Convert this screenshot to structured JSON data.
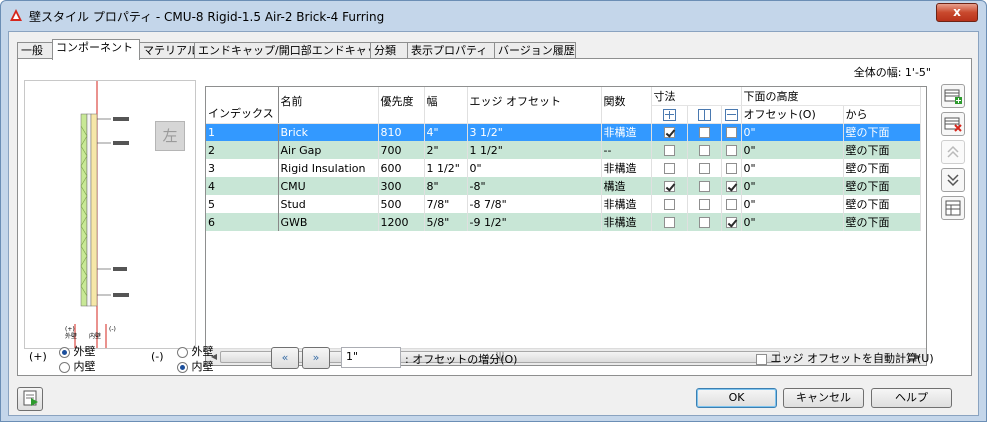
{
  "window": {
    "title": "壁スタイル プロパティ - CMU-8 Rigid-1.5 Air-2 Brick-4 Furring",
    "close_label": "x"
  },
  "tabs": [
    {
      "label": "一般"
    },
    {
      "label": "コンポーネント",
      "active": true
    },
    {
      "label": "マテリアル"
    },
    {
      "label": "エンドキャップ/開口部エンドキャップ"
    },
    {
      "label": "分類"
    },
    {
      "label": "表示プロパティ"
    },
    {
      "label": "バージョン履歴"
    }
  ],
  "component": {
    "total_width": "全体の幅: 1'-5\"",
    "view_button": "左",
    "preview_labels": {
      "inner_bottom": "(+)\n外壁",
      "outer_bottom": "内壁(-)"
    }
  },
  "grid": {
    "headers": {
      "index": "インデックス",
      "name": "名前",
      "priority": "優先度",
      "width": "幅",
      "edge_offset": "エッジ オフセット",
      "function": "関数",
      "dimension": "寸法",
      "bottom_elevation": "下面の高度",
      "offset": "オフセット(O)",
      "from": "から"
    },
    "rows": [
      {
        "index": "1",
        "name": "Brick",
        "priority": "810",
        "width": "4\"",
        "edge_offset": "3 1/2\"",
        "function": "非構造",
        "d1": true,
        "d2": false,
        "d3": false,
        "offset": "0\"",
        "from": "壁の下面",
        "selected": true
      },
      {
        "index": "2",
        "name": "Air Gap",
        "priority": "700",
        "width": "2\"",
        "edge_offset": "1 1/2\"",
        "function": "--",
        "d1": false,
        "d2": false,
        "d3": false,
        "offset": "0\"",
        "from": "壁の下面"
      },
      {
        "index": "3",
        "name": "Rigid Insulation",
        "priority": "600",
        "width": "1 1/2\"",
        "edge_offset": "0\"",
        "function": "非構造",
        "d1": false,
        "d2": false,
        "d3": false,
        "offset": "0\"",
        "from": "壁の下面"
      },
      {
        "index": "4",
        "name": "CMU",
        "priority": "300",
        "width": "8\"",
        "edge_offset": "-8\"",
        "function": "構造",
        "d1": true,
        "d2": false,
        "d3": true,
        "offset": "0\"",
        "from": "壁の下面"
      },
      {
        "index": "5",
        "name": "Stud",
        "priority": "500",
        "width": "7/8\"",
        "edge_offset": "-8 7/8\"",
        "function": "非構造",
        "d1": false,
        "d2": false,
        "d3": false,
        "offset": "0\"",
        "from": "壁の下面"
      },
      {
        "index": "6",
        "name": "GWB",
        "priority": "1200",
        "width": "5/8\"",
        "edge_offset": "-9 1/2\"",
        "function": "非構造",
        "d1": false,
        "d2": false,
        "d3": true,
        "offset": "0\"",
        "from": "壁の下面"
      }
    ]
  },
  "controls": {
    "plus_label": "(+)",
    "minus_label": "(-)",
    "outer_wall": "外壁",
    "inner_wall": "内壁",
    "increment_value": "1\"",
    "increment_label": ": オフセットの増分(O)",
    "auto_calc_label": "エッジ オフセットを自動計算(U)"
  },
  "footer": {
    "ok": "OK",
    "cancel": "キャンセル",
    "help": "ヘルプ"
  },
  "colors": {
    "selected_row": "#3399ff",
    "alt_row": "#c8e6d6",
    "window_frame": "#c4d6ea"
  }
}
